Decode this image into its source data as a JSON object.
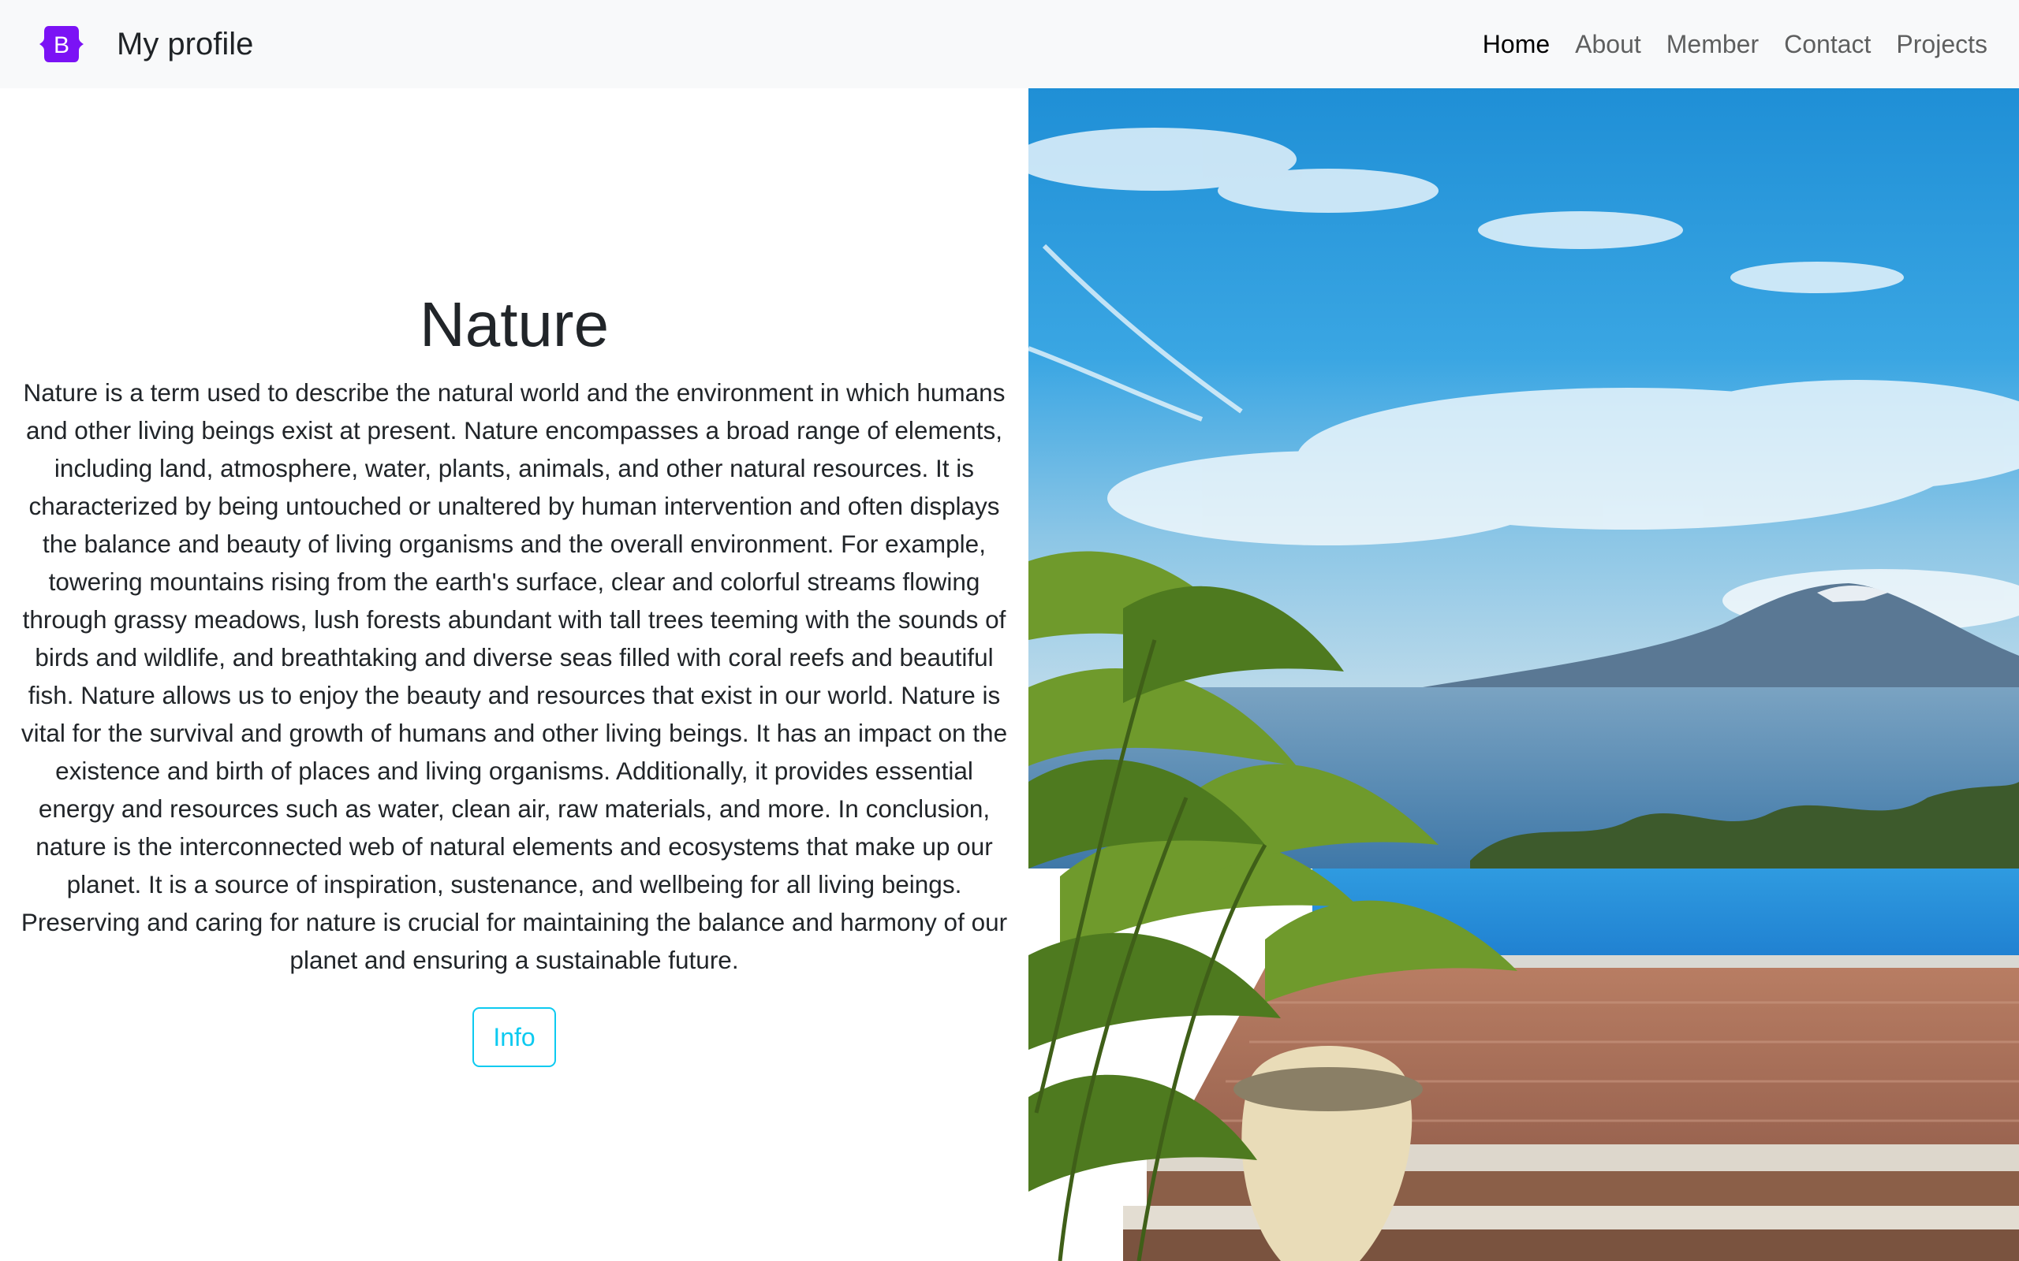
{
  "navbar": {
    "brand_letter": "B",
    "brand_name": "My profile",
    "links": [
      "Home",
      "About",
      "Member",
      "Contact",
      "Projects"
    ],
    "active_link": "Home"
  },
  "hero": {
    "title": "Nature",
    "description": "Nature is a term used to describe the natural world and the environment in which humans and other living beings exist at present. Nature encompasses a broad range of elements, including land, atmosphere, water, plants, animals, and other natural resources. It is characterized by being untouched or unaltered by human intervention and often displays the balance and beauty of living organisms and the overall environment. For example, towering mountains rising from the earth's surface, clear and colorful streams flowing through grassy meadows, lush forests abundant with tall trees teeming with the sounds of birds and wildlife, and breathtaking and diverse seas filled with coral reefs and beautiful fish. Nature allows us to enjoy the beauty and resources that exist in our world. Nature is vital for the survival and growth of humans and other living beings. It has an impact on the existence and birth of places and living organisms. Additionally, it provides essential energy and resources such as water, clean air, raw materials, and more. In conclusion, nature is the interconnected web of natural elements and ecosystems that make up our planet. It is a source of inspiration, sustenance, and wellbeing for all living beings. Preserving and caring for nature is crucial for maintaining the balance and harmony of our planet and ensuring a sustainable future.",
    "button_label": "Info"
  },
  "colors": {
    "brand_purple": "#7b12f5",
    "navbar_bg": "#f8f9fa",
    "info_cyan": "#0dcaf0",
    "text_dark": "#212529"
  },
  "icons": {
    "brand": "bootstrap-logo-icon"
  }
}
